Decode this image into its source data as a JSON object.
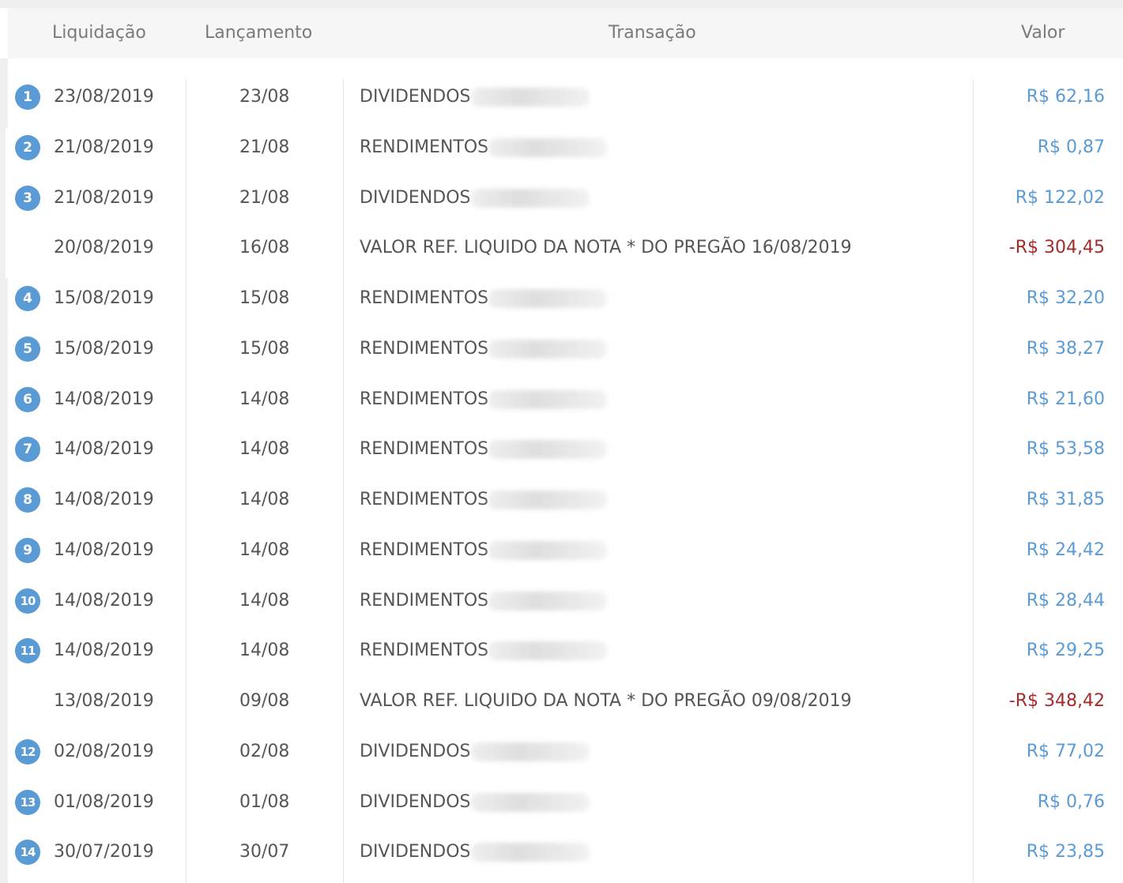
{
  "header": {
    "liquidacao": "Liquidação",
    "lancamento": "Lançamento",
    "transacao": "Transação",
    "valor": "Valor"
  },
  "colors": {
    "positive": "#5b9bd5",
    "negative": "#a52a2a",
    "badge": "#5b9bd5"
  },
  "rows": [
    {
      "badge": "1",
      "liquidacao": "23/08/2019",
      "lancamento": "23/08",
      "transacao": "DIVIDENDOS",
      "redacted": true,
      "valor": "R$ 62,16",
      "sign": "pos"
    },
    {
      "badge": "2",
      "liquidacao": "21/08/2019",
      "lancamento": "21/08",
      "transacao": "RENDIMENTOS",
      "redacted": true,
      "valor": "R$ 0,87",
      "sign": "pos"
    },
    {
      "badge": "3",
      "liquidacao": "21/08/2019",
      "lancamento": "21/08",
      "transacao": "DIVIDENDOS",
      "redacted": true,
      "valor": "R$ 122,02",
      "sign": "pos"
    },
    {
      "badge": "",
      "liquidacao": "20/08/2019",
      "lancamento": "16/08",
      "transacao": "VALOR REF. LIQUIDO DA NOTA * DO PREGÃO 16/08/2019",
      "redacted": false,
      "valor": "-R$ 304,45",
      "sign": "neg"
    },
    {
      "badge": "4",
      "liquidacao": "15/08/2019",
      "lancamento": "15/08",
      "transacao": "RENDIMENTOS",
      "redacted": true,
      "valor": "R$ 32,20",
      "sign": "pos"
    },
    {
      "badge": "5",
      "liquidacao": "15/08/2019",
      "lancamento": "15/08",
      "transacao": "RENDIMENTOS",
      "redacted": true,
      "valor": "R$ 38,27",
      "sign": "pos"
    },
    {
      "badge": "6",
      "liquidacao": "14/08/2019",
      "lancamento": "14/08",
      "transacao": "RENDIMENTOS",
      "redacted": true,
      "valor": "R$ 21,60",
      "sign": "pos"
    },
    {
      "badge": "7",
      "liquidacao": "14/08/2019",
      "lancamento": "14/08",
      "transacao": "RENDIMENTOS",
      "redacted": true,
      "valor": "R$ 53,58",
      "sign": "pos"
    },
    {
      "badge": "8",
      "liquidacao": "14/08/2019",
      "lancamento": "14/08",
      "transacao": "RENDIMENTOS",
      "redacted": true,
      "valor": "R$ 31,85",
      "sign": "pos"
    },
    {
      "badge": "9",
      "liquidacao": "14/08/2019",
      "lancamento": "14/08",
      "transacao": "RENDIMENTOS",
      "redacted": true,
      "valor": "R$ 24,42",
      "sign": "pos"
    },
    {
      "badge": "10",
      "liquidacao": "14/08/2019",
      "lancamento": "14/08",
      "transacao": "RENDIMENTOS",
      "redacted": true,
      "valor": "R$ 28,44",
      "sign": "pos"
    },
    {
      "badge": "11",
      "liquidacao": "14/08/2019",
      "lancamento": "14/08",
      "transacao": "RENDIMENTOS",
      "redacted": true,
      "valor": "R$ 29,25",
      "sign": "pos"
    },
    {
      "badge": "",
      "liquidacao": "13/08/2019",
      "lancamento": "09/08",
      "transacao": "VALOR REF. LIQUIDO DA NOTA * DO PREGÃO 09/08/2019",
      "redacted": false,
      "valor": "-R$ 348,42",
      "sign": "neg"
    },
    {
      "badge": "12",
      "liquidacao": "02/08/2019",
      "lancamento": "02/08",
      "transacao": "DIVIDENDOS",
      "redacted": true,
      "valor": "R$ 77,02",
      "sign": "pos"
    },
    {
      "badge": "13",
      "liquidacao": "01/08/2019",
      "lancamento": "01/08",
      "transacao": "DIVIDENDOS",
      "redacted": true,
      "valor": "R$ 0,76",
      "sign": "pos"
    },
    {
      "badge": "14",
      "liquidacao": "30/07/2019",
      "lancamento": "30/07",
      "transacao": "DIVIDENDOS",
      "redacted": true,
      "valor": "R$ 23,85",
      "sign": "pos"
    }
  ]
}
